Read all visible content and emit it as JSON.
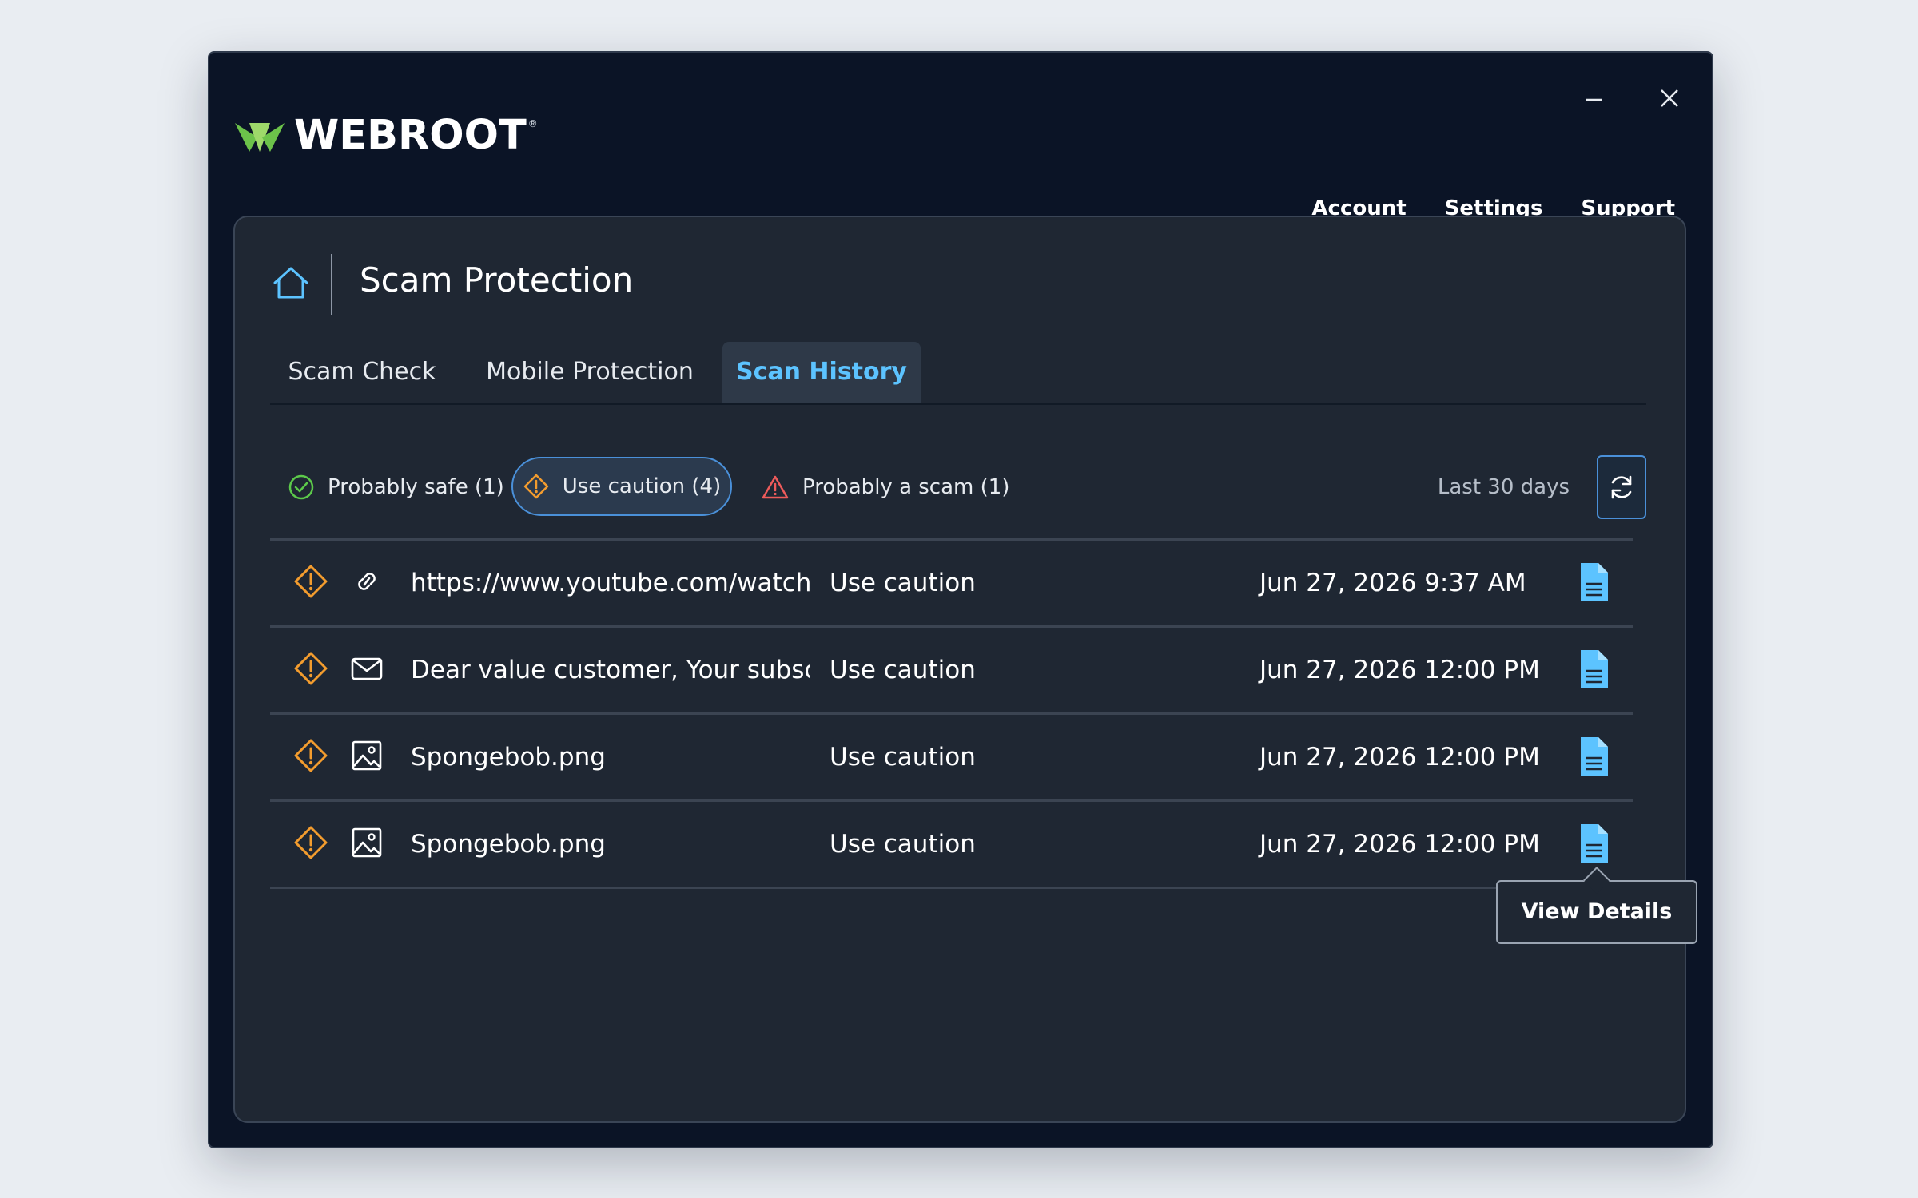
{
  "app": {
    "brand": "WEBROOT",
    "brand_mark": "®"
  },
  "nav": {
    "account": "Account",
    "settings": "Settings",
    "support": "Support"
  },
  "page": {
    "title": "Scam Protection"
  },
  "tabs": [
    {
      "label": "Scam Check",
      "active": false
    },
    {
      "label": "Mobile Protection",
      "active": false
    },
    {
      "label": "Scan History",
      "active": true
    }
  ],
  "filters": {
    "safe": "Probably safe (1)",
    "caution": "Use caution (4)",
    "scam": "Probably a scam (1)",
    "selected": "caution",
    "range": "Last 30 days"
  },
  "rows": [
    {
      "type_icon": "link-icon",
      "name": "https://www.youtube.com/watch?v...",
      "verdict": "Use caution",
      "date": "Jun 27, 2026 9:37 AM"
    },
    {
      "type_icon": "mail-icon",
      "name": "Dear value customer, Your subscri...",
      "verdict": "Use caution",
      "date": "Jun 27, 2026 12:00 PM"
    },
    {
      "type_icon": "image-icon",
      "name": "Spongebob.png",
      "verdict": "Use caution",
      "date": "Jun 27, 2026 12:00 PM"
    },
    {
      "type_icon": "image-icon",
      "name": "Spongebob.png",
      "verdict": "Use caution",
      "date": "Jun 27, 2026 12:00 PM"
    }
  ],
  "tooltip": {
    "label": "View Details"
  },
  "colors": {
    "window_bg": "#0b1426",
    "panel_bg": "#1f2733",
    "accent_blue": "#5cc3ff",
    "caution_orange": "#f39c2e",
    "safe_green": "#5cc94a",
    "scam_red": "#ee5b5b",
    "brand_green": "#6cc24a"
  }
}
